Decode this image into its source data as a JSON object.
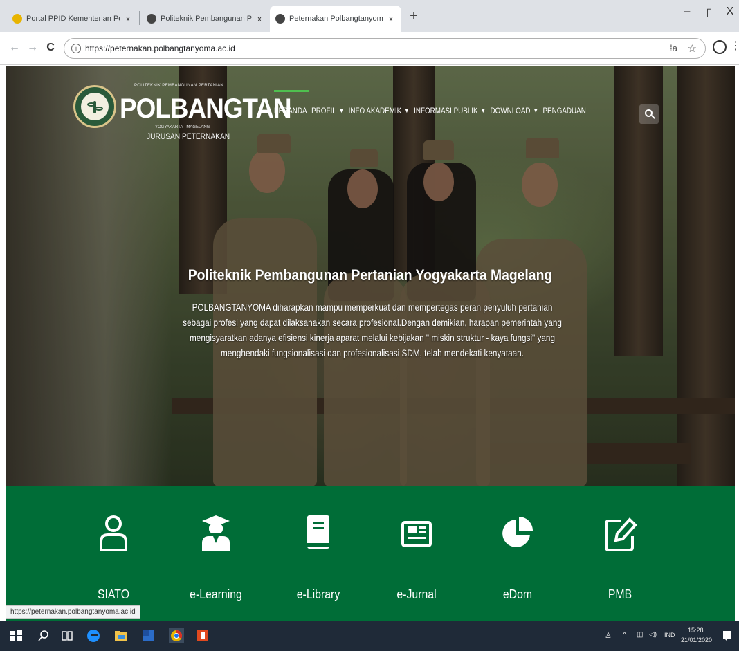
{
  "browser": {
    "tabs": [
      {
        "title": "Portal PPID Kementerian Pertani",
        "favicon_color": "#e8b400"
      },
      {
        "title": "Politeknik Pembangunan Pertani",
        "favicon_color": "#444444"
      },
      {
        "title": "Peternakan Polbangtanyoma – P",
        "favicon_color": "#444444",
        "active": true
      }
    ],
    "close_glyph": "x",
    "newtab_glyph": "+",
    "window_controls": {
      "minimize": "–",
      "restore": "▯",
      "close": "X"
    },
    "nav": {
      "back": "←",
      "forward": "→",
      "reload": "C"
    },
    "url": "https://peternakan.polbangtanyoma.ac.id",
    "status_url": "https://peternakan.polbangtanyoma.ac.id"
  },
  "site": {
    "logo": {
      "top_text": "POLITEKNIK PEMBANGUNAN PERTANIAN",
      "main_text": "POLBANGTAN",
      "sub_text": "YOGYAKARTA · MAGELANG",
      "department": "JURUSAN PETERNAKAN"
    },
    "nav": [
      {
        "label": "BERANDA",
        "has_dropdown": false
      },
      {
        "label": "PROFIL",
        "has_dropdown": true
      },
      {
        "label": "INFO AKADEMIK",
        "has_dropdown": true
      },
      {
        "label": "INFORMASI PUBLIK",
        "has_dropdown": true
      },
      {
        "label": "DOWNLOAD",
        "has_dropdown": true
      },
      {
        "label": "PENGADUAN",
        "has_dropdown": false
      }
    ],
    "hero": {
      "title": "Politeknik Pembangunan Pertanian Yogyakarta Magelang",
      "description_lines": [
        "POLBANGTANYOMA diharapkan mampu memperkuat dan mempertegas peran penyuluh pertanian",
        "sebagai profesi yang dapat dilaksanakan secara profesional.Dengan demikian, harapan pemerintah yang",
        "mengisyaratkan adanya efisiensi kinerja aparat melalui kebijakan \" miskin struktur - kaya fungsi\" yang",
        "menghendaki fungsionalisasi dan profesionalisasi SDM, telah mendekati kenyataan."
      ]
    },
    "services": [
      {
        "label": "SIATO",
        "icon": "user-icon"
      },
      {
        "label": "e-Learning",
        "icon": "graduate-icon"
      },
      {
        "label": "e-Library",
        "icon": "book-icon"
      },
      {
        "label": "e-Jurnal",
        "icon": "newspaper-icon"
      },
      {
        "label": "eDom",
        "icon": "pie-chart-icon"
      },
      {
        "label": "PMB",
        "icon": "edit-icon"
      }
    ],
    "colors": {
      "services_bg": "#006d37",
      "nav_active": "#4fbf4f"
    }
  },
  "taskbar": {
    "lang": "IND",
    "time": "15:28",
    "date": "21/01/2020"
  }
}
